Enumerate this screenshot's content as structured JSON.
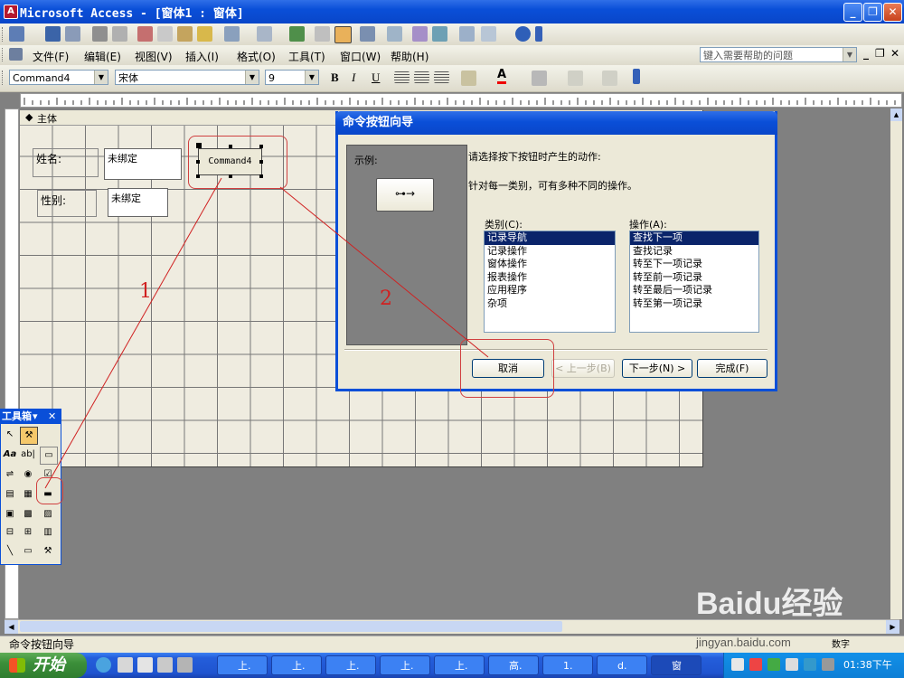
{
  "window": {
    "title": "Microsoft Access - [窗体1 : 窗体]",
    "app_icon": "A"
  },
  "menu": {
    "items": [
      "文件(F)",
      "编辑(E)",
      "视图(V)",
      "插入(I)",
      "格式(O)",
      "工具(T)",
      "窗口(W)",
      "帮助(H)"
    ],
    "help_placeholder": "键入需要帮助的问题"
  },
  "format_bar": {
    "object_combo": "Command4",
    "font_combo": "宋体",
    "size_combo": "9",
    "bold": "B",
    "italic": "I",
    "underline": "U"
  },
  "form": {
    "section": "主体",
    "label_name": "姓名:",
    "label_gender": "性别:",
    "text_unbound_1": "未绑定",
    "text_unbound_2": "未绑定",
    "command_button": "Command4"
  },
  "dialog": {
    "title": "命令按钮向导",
    "sample_label": "示例:",
    "instruction": "请选择按下按钮时产生的动作:",
    "hint": "针对每一类别，可有多种不同的操作。",
    "category_label": "类别(C):",
    "action_label": "操作(A):",
    "categories": [
      "记录导航",
      "记录操作",
      "窗体操作",
      "报表操作",
      "应用程序",
      "杂项"
    ],
    "actions": [
      "查找下一项",
      "查找记录",
      "转至下一项记录",
      "转至前一项记录",
      "转至最后一项记录",
      "转至第一项记录"
    ],
    "btn_cancel": "取消",
    "btn_back": "< 上一步(B)",
    "btn_next": "下一步(N) >",
    "btn_finish": "完成(F)"
  },
  "toolbox": {
    "title": "工具箱"
  },
  "annotations": {
    "one": "1",
    "two": "2"
  },
  "status": {
    "text": "命令按钮向导",
    "mode": "数字"
  },
  "taskbar": {
    "start": "开始",
    "items": [
      "上.",
      "上.",
      "上.",
      "上.",
      "上.",
      "高.",
      "1.",
      "d.",
      "窗"
    ],
    "clock": "01:38下午"
  },
  "watermark": {
    "brand": "Baidu经验",
    "url": "jingyan.baidu.com"
  },
  "colors": {
    "titlebar": "#0a4fd8",
    "selection": "#0a246a",
    "annotation": "#d02020"
  }
}
